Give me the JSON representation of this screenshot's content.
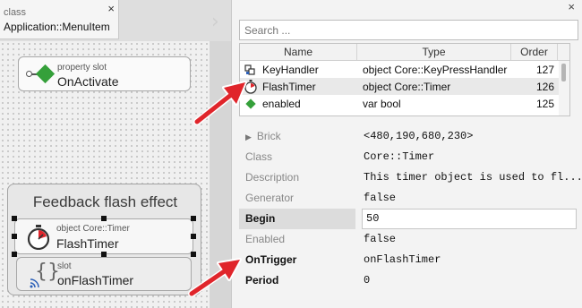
{
  "doc_tab": {
    "kind": "class",
    "name": "Application::MenuItem",
    "close": "×"
  },
  "canvas": {
    "property_slot": {
      "kind": "property slot",
      "name": "OnActivate"
    },
    "annotation": {
      "title": "Feedback flash effect"
    },
    "timer_brick": {
      "kind": "object Core::Timer",
      "name": "FlashTimer"
    },
    "slot_brick": {
      "kind": "slot",
      "name": "onFlashTimer"
    }
  },
  "inspector": {
    "close": "×",
    "search": {
      "placeholder": "Search ..."
    },
    "members": {
      "columns": [
        "Name",
        "Type",
        "Order"
      ],
      "rows": [
        {
          "name": "KeyHandler",
          "type": "object Core::KeyPressHandler",
          "order": "127",
          "icon": "keyhandler-icon"
        },
        {
          "name": "FlashTimer",
          "type": "object Core::Timer",
          "order": "126",
          "icon": "timer-icon"
        },
        {
          "name": "enabled",
          "type": "var bool",
          "order": "125",
          "icon": "green-diamond-icon"
        }
      ]
    },
    "properties": [
      {
        "name": "Brick",
        "value": "<480,190,680,230>"
      },
      {
        "name": "Class",
        "value": "Core::Timer"
      },
      {
        "name": "Description",
        "value": "This timer object is used to fl..."
      },
      {
        "name": "Generator",
        "value": "false"
      },
      {
        "name": "Begin",
        "value": "50"
      },
      {
        "name": "Enabled",
        "value": "false"
      },
      {
        "name": "OnTrigger",
        "value": "onFlashTimer"
      },
      {
        "name": "Period",
        "value": "0"
      }
    ]
  },
  "colors": {
    "accent_red": "#e0252b",
    "diamond_green": "#35a03a"
  }
}
